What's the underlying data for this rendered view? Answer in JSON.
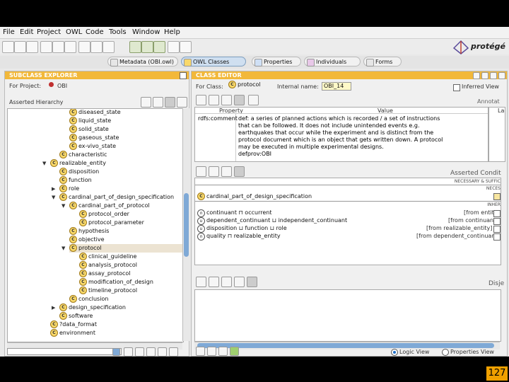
{
  "menu": [
    "File",
    "Edit",
    "Project",
    "OWL",
    "Code",
    "Tools",
    "Window",
    "Help"
  ],
  "logo": {
    "text": "protégé"
  },
  "tabs": [
    {
      "label": "Metadata (OBI.owl)",
      "icon": "metadata-icon"
    },
    {
      "label": "OWL Classes",
      "icon": "owl-classes-icon"
    },
    {
      "label": "Properties",
      "icon": "properties-icon"
    },
    {
      "label": "Individuals",
      "icon": "individuals-icon"
    },
    {
      "label": "Forms",
      "icon": "forms-icon"
    }
  ],
  "subclass_explorer": {
    "title": "SUBCLASS EXPLORER",
    "for_project_label": "For Project:",
    "project": "OBI",
    "asserted_hierarchy": "Asserted Hierarchy",
    "tree": [
      {
        "label": "diseased_state"
      },
      {
        "label": "liquid_state"
      },
      {
        "label": "solid_state"
      },
      {
        "label": "gaseous_state"
      },
      {
        "label": "ex-vivo_state"
      },
      {
        "label": "characteristic"
      },
      {
        "label": "realizable_entity"
      },
      {
        "label": "disposition"
      },
      {
        "label": "function"
      },
      {
        "label": "role"
      },
      {
        "label": "cardinal_part_of_design_specification"
      },
      {
        "label": "cardinal_part_of_protocol"
      },
      {
        "label": "protocol_order"
      },
      {
        "label": "protocol_parameter"
      },
      {
        "label": "hypothesis"
      },
      {
        "label": "objective"
      },
      {
        "label": "protocol"
      },
      {
        "label": "clinical_guideline"
      },
      {
        "label": "analysis_protocol"
      },
      {
        "label": "assay_protocol"
      },
      {
        "label": "modification_of_design"
      },
      {
        "label": "timeline_protocol"
      },
      {
        "label": "conclusion"
      },
      {
        "label": "design_specification"
      },
      {
        "label": "software"
      },
      {
        "label": "?data_format"
      },
      {
        "label": "environment"
      }
    ]
  },
  "class_editor": {
    "title": "CLASS EDITOR",
    "for_class_label": "For Class:",
    "class_name": "protocol",
    "internal_name_label": "Internal name:",
    "internal_name": "OBI_14",
    "inferred_view": "Inferred View",
    "annotations_label": "Annotat",
    "col_property": "Property",
    "col_value": "Value",
    "col_lang": "La",
    "annotation_property": "rdfs:comment",
    "annotation_value": [
      "def: a series of planned actions which is recorded / a set of instructions",
      "that can be followed. It does not include unintended events e.g.",
      "earthquakes that occur while the experiment and is distinct from the",
      "protocol document which is an object that gets written down.  A protocol",
      "may be executed in multiple experimental designs.",
      "defprov:OBI"
    ],
    "asserted_conditions": "Asserted Condit",
    "necessary_sufficient": "NECESSARY & SUFFIC",
    "neces": "NECES",
    "inher": "INHER",
    "superclass": "cardinal_part_of_design_specification",
    "conditions": [
      {
        "expr": "continuant ⊓ occurrent",
        "source": "[from entity]"
      },
      {
        "expr": "dependent_continuant ⊔ independent_continuant",
        "source": "[from continuant]"
      },
      {
        "expr": "disposition ⊔ function ⊔ role",
        "source": "[from realizable_entity]"
      },
      {
        "expr": "quality ⊓ realizable_entity",
        "source": "[from dependent_continuant]"
      }
    ],
    "disjoints_label": "Disje",
    "logic_view": "Logic View",
    "properties_view": "Properties View"
  },
  "page_number": "127"
}
